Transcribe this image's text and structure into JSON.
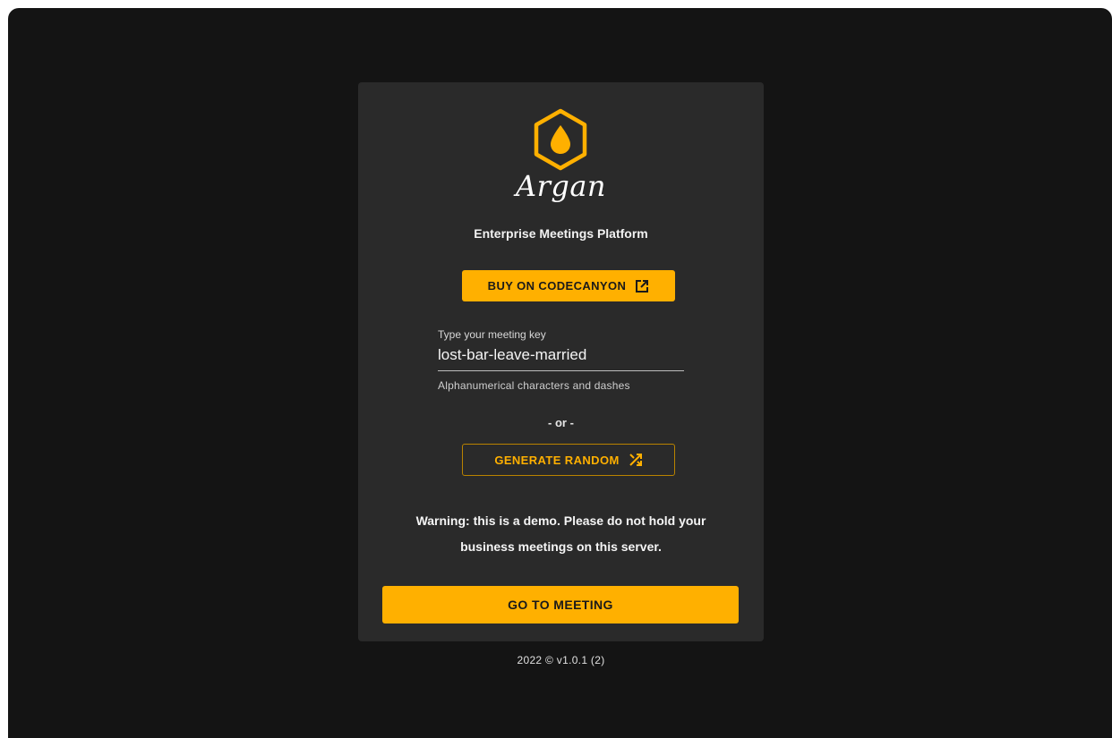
{
  "brand": {
    "name": "Argan",
    "tagline": "Enterprise Meetings Platform",
    "logo_icon": "drop-hexagon-icon"
  },
  "buy": {
    "label": "BUY ON CODECANYON",
    "icon": "external-link-icon"
  },
  "meeting_key": {
    "label": "Type your meeting key",
    "value": "lost-bar-leave-married",
    "helper": "Alphanumerical characters and dashes"
  },
  "separator": "- or -",
  "generate": {
    "label": "GENERATE RANDOM",
    "icon": "shuffle-icon"
  },
  "warning": "Warning: this is a demo. Please do not hold your business meetings on this server.",
  "go": {
    "label": "GO TO MEETING"
  },
  "footer": "2022 © v1.0.1 (2)",
  "colors": {
    "background": "#141414",
    "card": "#2a2a2a",
    "accent": "#ffb000"
  }
}
